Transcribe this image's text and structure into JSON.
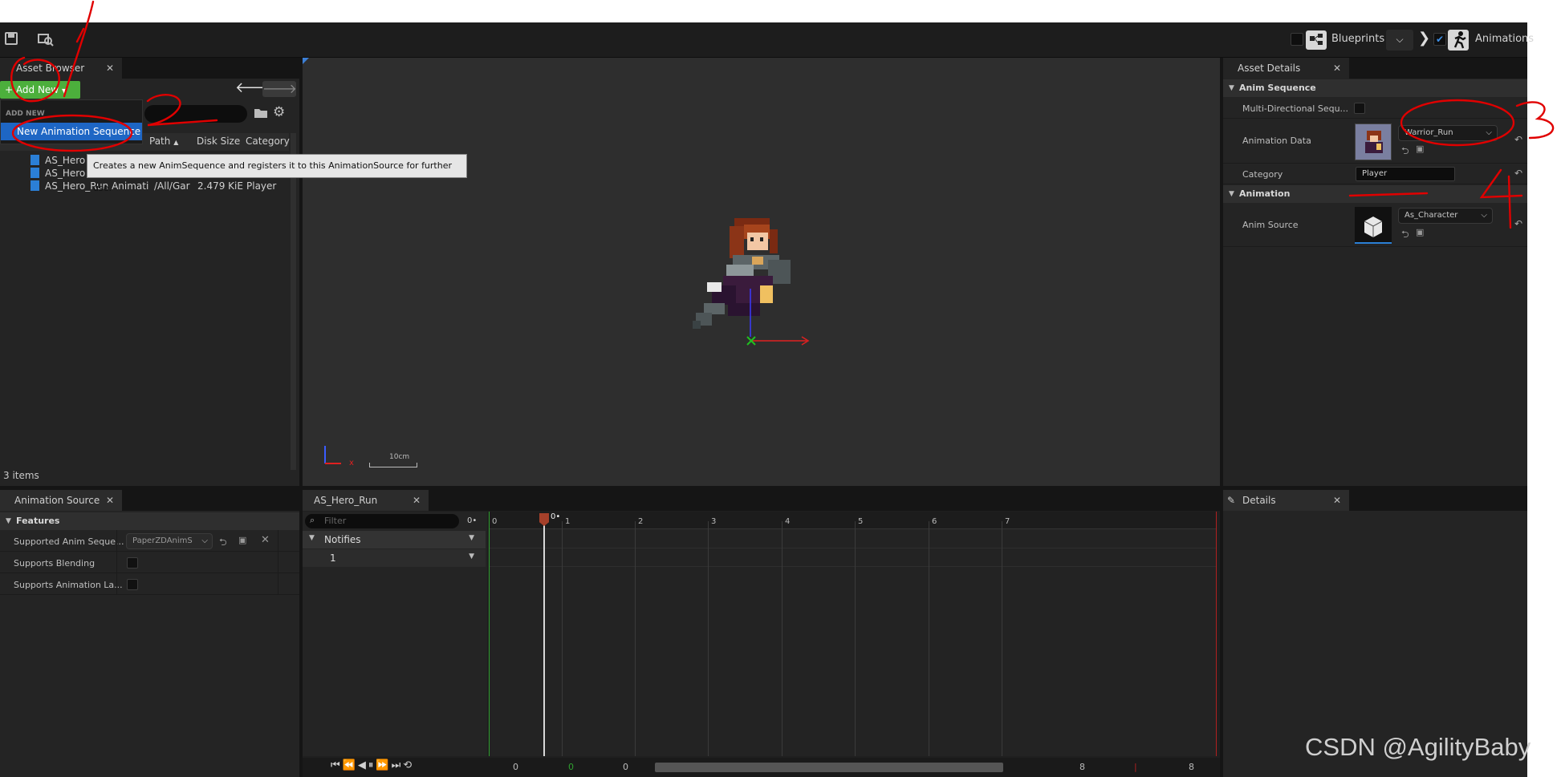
{
  "top_bar": {
    "blueprints_label": "Blueprints",
    "animations_label": "Animations"
  },
  "asset_browser": {
    "tab_label": "Asset Browser",
    "add_new_label": "Add New",
    "menu_section": "ADD NEW",
    "menu_item": "New Animation Sequence",
    "tooltip": "Creates a new AnimSequence and registers it to this AnimationSource for further use.",
    "columns": [
      "Path",
      "Disk Size",
      "Category"
    ],
    "rows": [
      {
        "name": "AS_Hero",
        "path": "",
        "size": "",
        "category": ""
      },
      {
        "name": "AS_Hero",
        "path": "",
        "size": "",
        "category": ""
      },
      {
        "name": "AS_Hero_Run Animati",
        "path": "/All/Gar",
        "size": "2.479 KiE",
        "category": "Player"
      }
    ],
    "items_count": "3 items"
  },
  "viewport": {
    "scale_label": "10cm",
    "axis_x": "x"
  },
  "asset_details": {
    "tab_label": "Asset Details",
    "section_anim_sequence": "Anim Sequence",
    "multi_directional_label": "Multi-Directional Sequ...",
    "animation_data_label": "Animation Data",
    "animation_data_value": "Warrior_Run",
    "category_label": "Category",
    "category_value": "Player",
    "section_animation": "Animation",
    "anim_source_label": "Anim Source",
    "anim_source_value": "As_Character"
  },
  "animation_source": {
    "tab_label": "Animation Source",
    "section_features": "Features",
    "supported_label": "Supported Anim Seque...",
    "supported_value": "PaperZDAnimS",
    "blending_label": "Supports Blending",
    "layering_label": "Supports Animation La..."
  },
  "timeline": {
    "tab_label": "AS_Hero_Run",
    "filter_placeholder": "Filter",
    "frame_readout": "0•",
    "notifies_label": "Notifies",
    "track_label": "1",
    "playhead_label": "0•",
    "ruler_ticks": [
      "0",
      "1",
      "2",
      "3",
      "4",
      "5",
      "6",
      "7"
    ],
    "bottom_start": "0",
    "bottom_current": "0",
    "bottom_range_start": "0",
    "bottom_range_end": "8",
    "bottom_end": "8"
  },
  "details": {
    "tab_label": "Details"
  },
  "annotations": {
    "n1": "1",
    "n2": "2",
    "n3": "3",
    "n4": "4"
  },
  "watermark": "CSDN @AgilityBaby"
}
